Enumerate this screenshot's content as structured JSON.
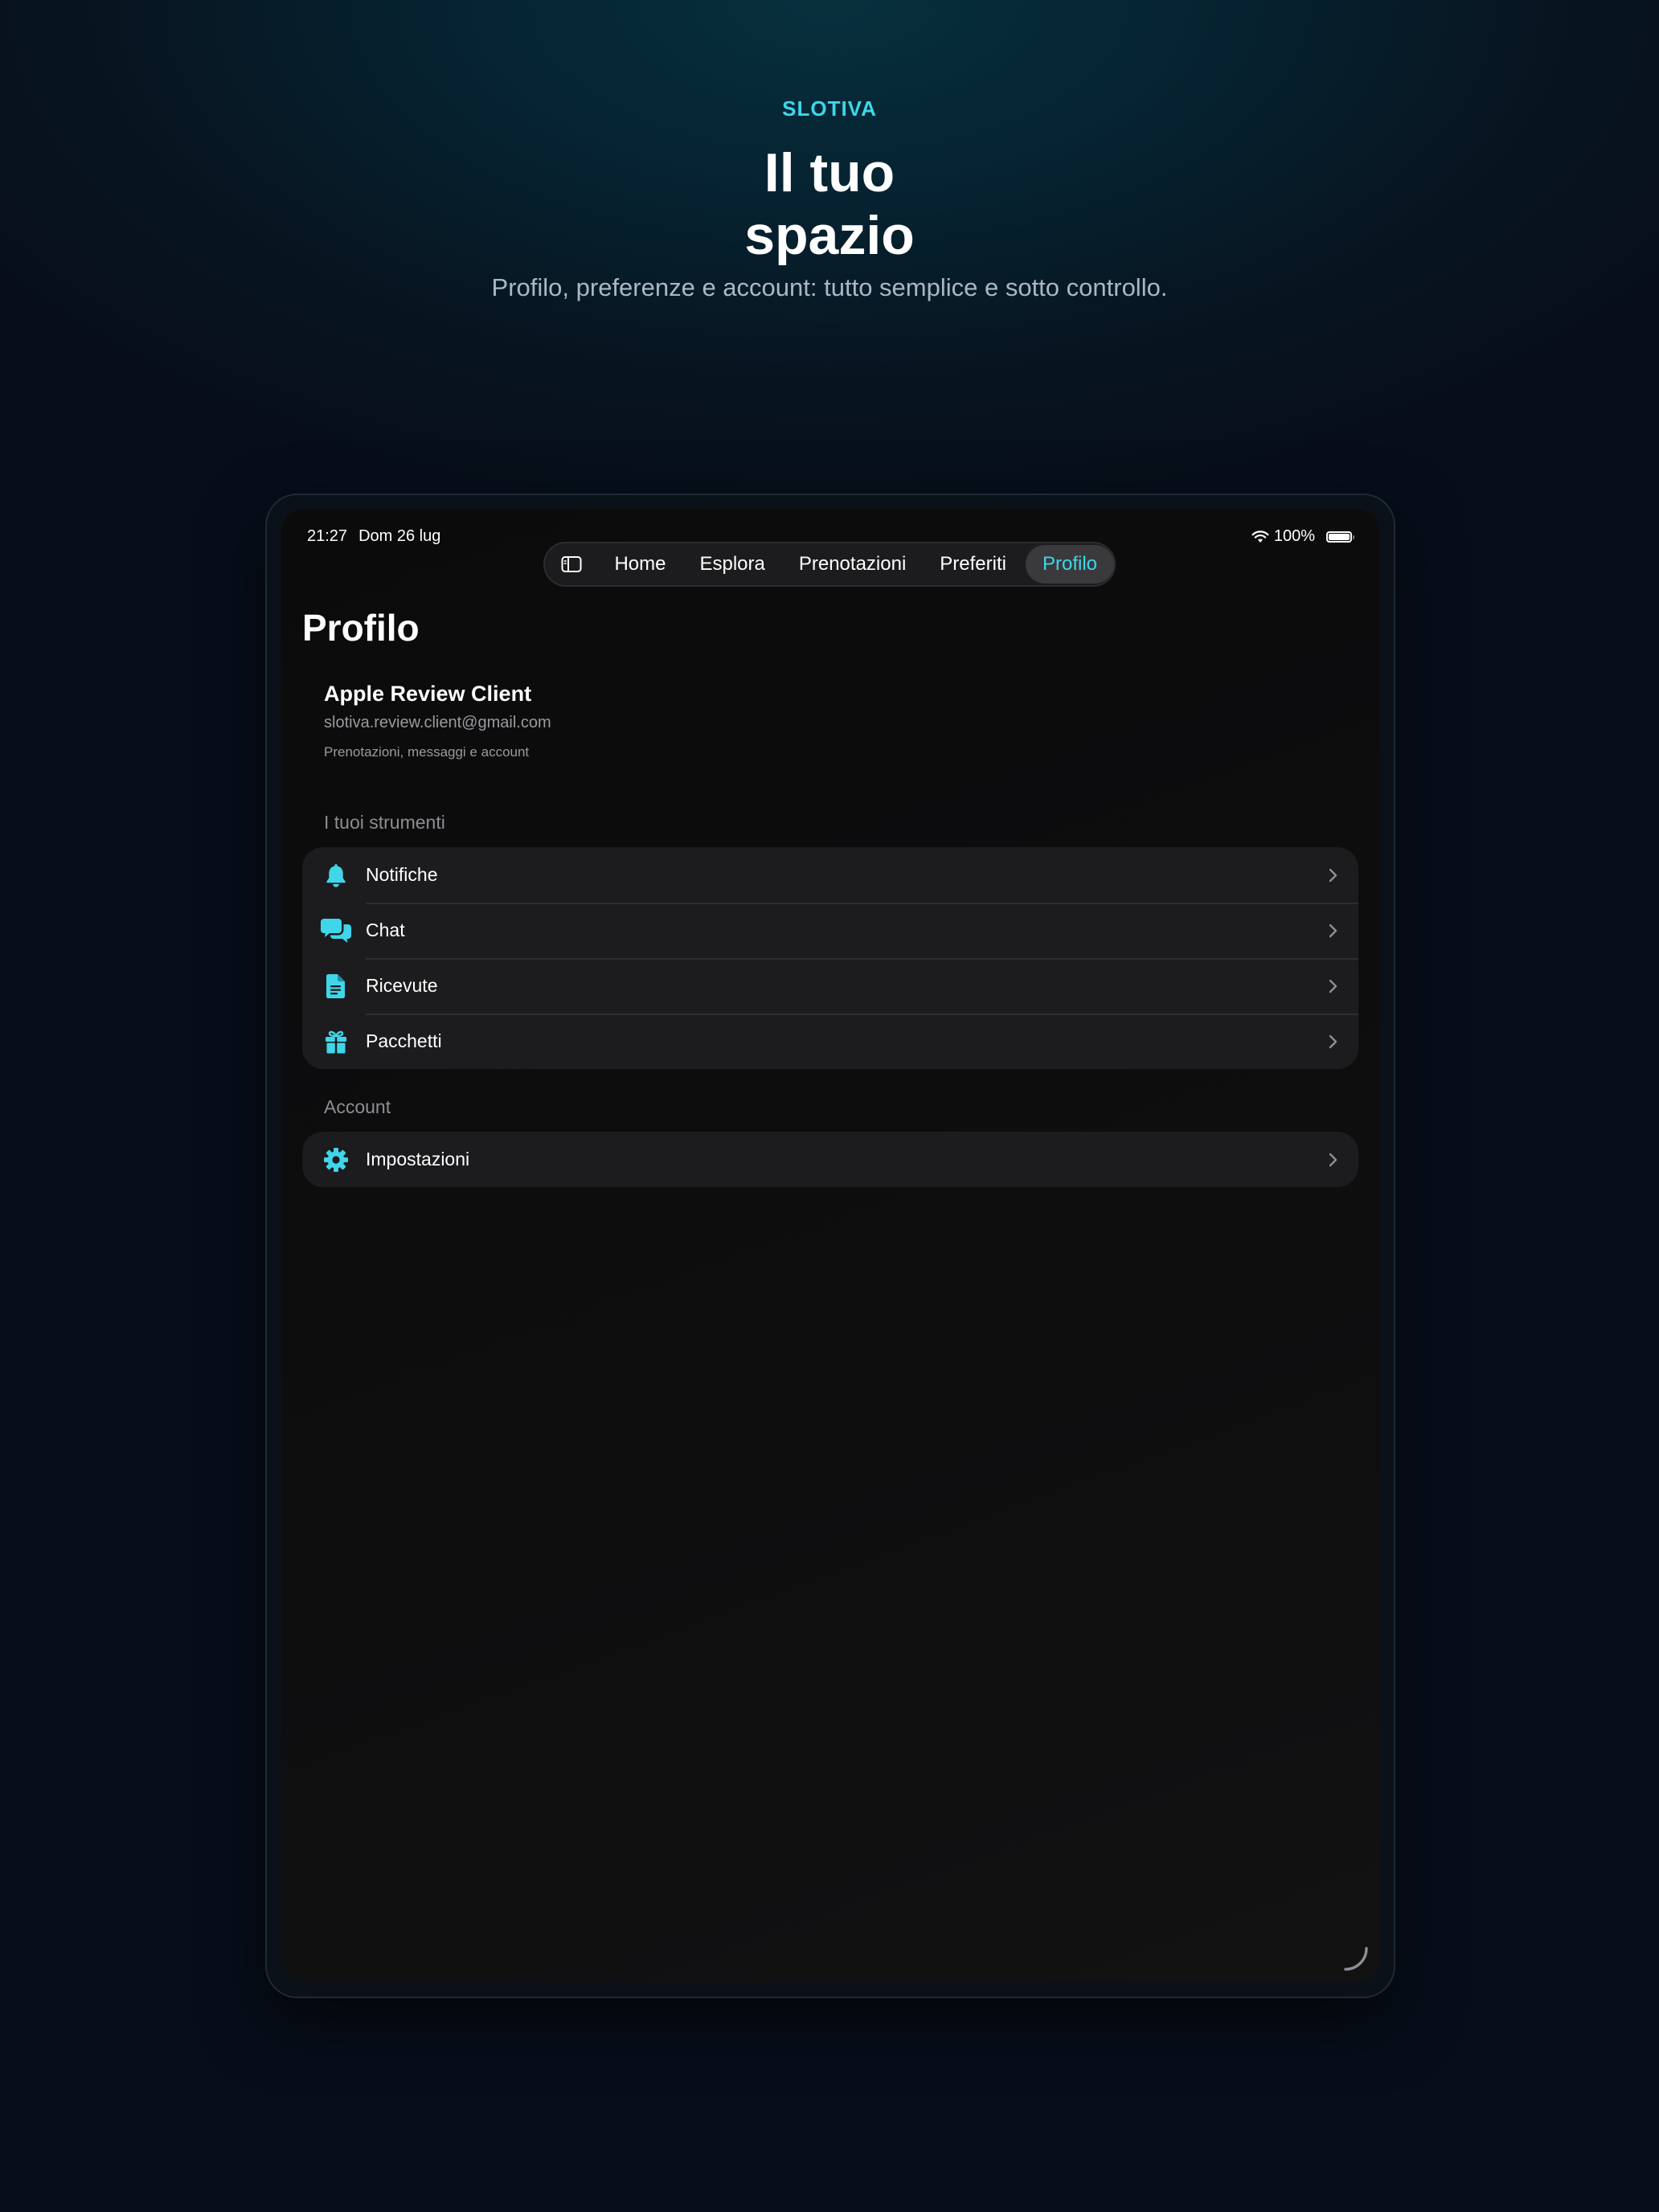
{
  "hero": {
    "brand": "SLOTIVA",
    "headline_line1": "Il tuo",
    "headline_line2": "spazio",
    "subline": "Profilo, preferenze e account: tutto semplice e sotto controllo."
  },
  "status_bar": {
    "time": "21:27",
    "date": "Dom 26 lug",
    "battery": "100%"
  },
  "tabs": [
    {
      "label": "Home",
      "active": false
    },
    {
      "label": "Esplora",
      "active": false
    },
    {
      "label": "Prenotazioni",
      "active": false
    },
    {
      "label": "Preferiti",
      "active": false
    },
    {
      "label": "Profilo",
      "active": true
    }
  ],
  "page": {
    "title": "Profilo"
  },
  "user": {
    "name": "Apple Review Client",
    "email": "slotiva.review.client@gmail.com",
    "description": "Prenotazioni, messaggi e account"
  },
  "sections": [
    {
      "label": "I tuoi strumenti",
      "items": [
        {
          "label": "Notifiche",
          "icon": "bell-icon"
        },
        {
          "label": "Chat",
          "icon": "chat-bubbles-icon"
        },
        {
          "label": "Ricevute",
          "icon": "document-icon"
        },
        {
          "label": "Pacchetti",
          "icon": "gift-icon"
        }
      ]
    },
    {
      "label": "Account",
      "items": [
        {
          "label": "Impostazioni",
          "icon": "gear-icon"
        }
      ]
    }
  ],
  "colors": {
    "accent": "#3fd6ea",
    "background": "#070e1a",
    "screen": "#0e0e0f",
    "card": "#1c1c1e",
    "secondary_text": "#9a9aa0"
  }
}
